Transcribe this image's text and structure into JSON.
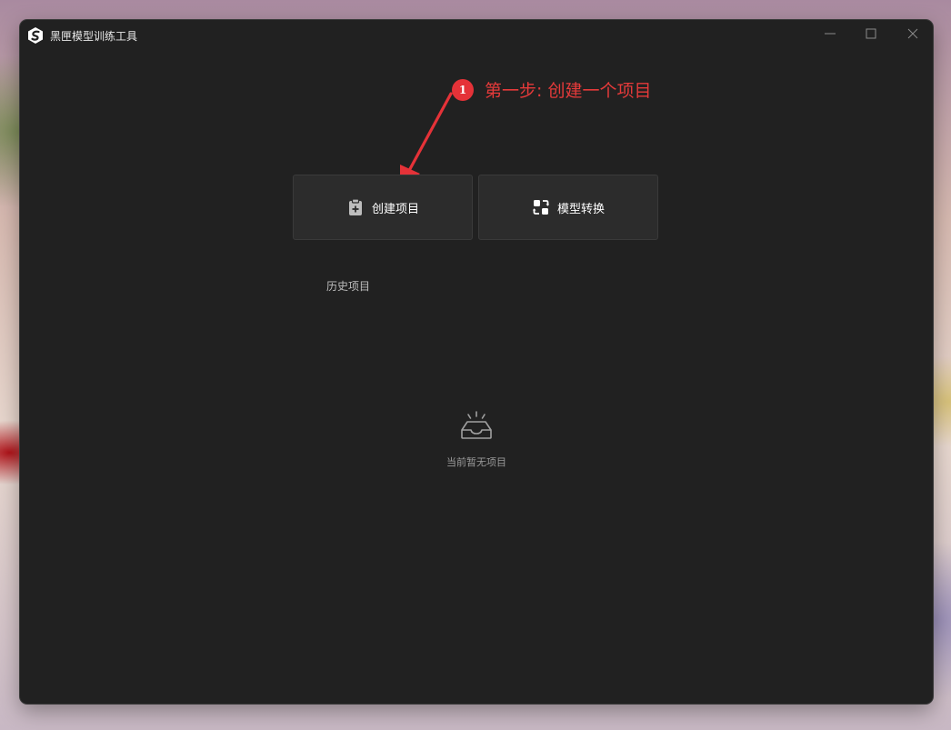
{
  "window": {
    "title": "黑匣模型训练工具",
    "logo_icon": "app-logo-icon",
    "controls": [
      "minimize-icon",
      "maximize-icon",
      "close-icon"
    ]
  },
  "annotation": {
    "badge": "1",
    "text": "第一步: 创建一个项目",
    "color": "#e53238"
  },
  "actions": {
    "create_project": {
      "label": "创建项目",
      "icon": "clipboard-add-icon"
    },
    "model_convert": {
      "label": "模型转换",
      "icon": "convert-icon"
    }
  },
  "history": {
    "title": "历史项目",
    "empty_icon": "empty-inbox-icon",
    "empty_text": "当前暂无项目"
  },
  "colors": {
    "window_bg": "#212121",
    "card_bg": "#2c2c2c",
    "accent_red": "#e53238"
  }
}
